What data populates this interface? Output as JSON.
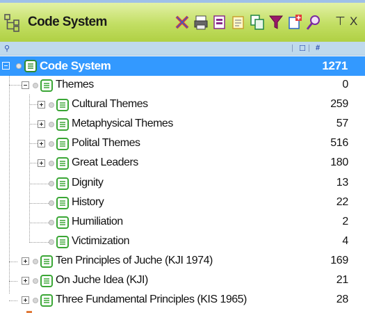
{
  "window": {
    "title": "Code System",
    "toolbar_icons": [
      "collapse-codes-icon",
      "print-icon",
      "export-icon",
      "notes-icon",
      "copy-icon",
      "filter-icon",
      "new-code-icon",
      "search-icon"
    ],
    "pin_label": "⊤",
    "close_label": "X"
  },
  "column_header": {
    "icon": "⚲",
    "col1": "☐",
    "col2": "#"
  },
  "tree": {
    "root": {
      "label": "Code System",
      "count": "1271"
    },
    "rows": [
      {
        "label": "Themes",
        "count": "0"
      },
      {
        "label": "Cultural Themes",
        "count": "259"
      },
      {
        "label": "Metaphysical Themes",
        "count": "57"
      },
      {
        "label": "Polital Themes",
        "count": "516"
      },
      {
        "label": "Great Leaders",
        "count": "180"
      },
      {
        "label": "Dignity",
        "count": "13"
      },
      {
        "label": "History",
        "count": "22"
      },
      {
        "label": "Humiliation",
        "count": "2"
      },
      {
        "label": "Victimization",
        "count": "4"
      },
      {
        "label": "Ten Principles of Juche (KJI 1974)",
        "count": "169"
      },
      {
        "label": "On Juche Idea (KJI)",
        "count": "21"
      },
      {
        "label": "Three Fundamental Principles (KIS 1965)",
        "count": "28"
      }
    ]
  },
  "colors": {
    "titlebar": "#c2de63",
    "selection": "#3399ff",
    "code_icon": "#3aa635"
  }
}
